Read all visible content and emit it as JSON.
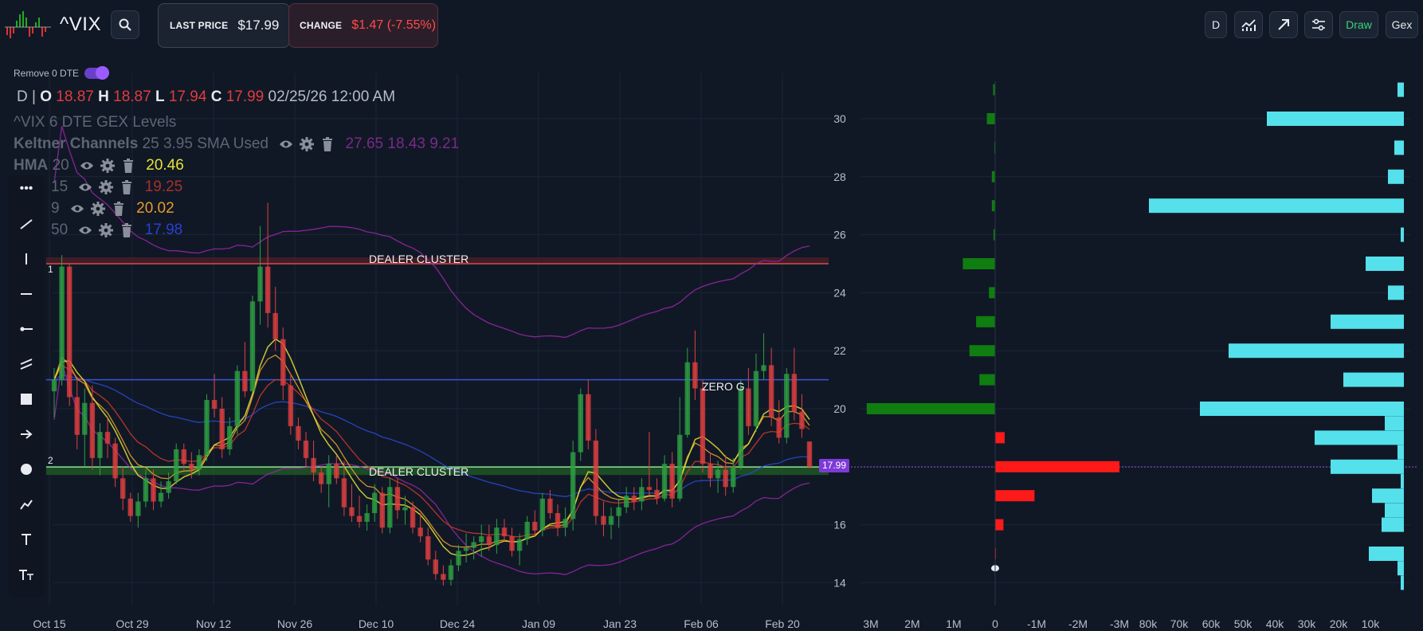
{
  "header": {
    "ticker": "^VIX",
    "last_price_label": "LAST PRICE",
    "last_price_value": "$17.99",
    "change_label": "CHANGE",
    "change_value": "$1.47 (-7.55%)",
    "interval_button": "D",
    "draw_button": "Draw",
    "gex_button": "Gex",
    "icons": [
      "search-icon",
      "chart-indicators-icon",
      "trend-arrow-icon",
      "settings-sliders-icon"
    ]
  },
  "controls": {
    "remove_dte_label": "Remove 0 DTE",
    "remove_dte_on": true
  },
  "legend": {
    "interval": "D",
    "o_label": "O",
    "open": "18.87",
    "h_label": "H",
    "high": "18.87",
    "l_label": "L",
    "low": "17.94",
    "c_label": "C",
    "close": "17.99",
    "datetime": "02/25/26 12:00 AM",
    "gex_title": "^VIX 6 DTE GEX Levels",
    "keltner_name": "Keltner Channels",
    "keltner_params": "25 3.95 SMA Used",
    "keltner_values": "27.65 18.43 9.21",
    "hma_name": "HMA",
    "hma_period": "20",
    "hma_value": "20.46",
    "ma2_period": "15",
    "ma2_value": "19.25",
    "ma3_period": "9",
    "ma3_value": "20.02",
    "ma4_period": "50",
    "ma4_value": "17.98"
  },
  "annotations": {
    "dealer_cluster_top": "DEALER CLUSTER",
    "dealer_cluster_bottom": "DEALER CLUSTER",
    "zero_g": "ZERO G",
    "marker_1": "1",
    "marker_2": "2",
    "price_tag": "17.99"
  },
  "colors": {
    "background": "#101826",
    "up": "#2ea043",
    "down": "#e04040",
    "gex_pos": "#0f7d10",
    "gex_neg": "#ff1a1a",
    "volume": "#54e1eb",
    "zero_g": "#3b55d6",
    "dealer": "#e04a4a",
    "keltner": "#9a27a8",
    "hma": "#e7e236",
    "ma15": "#d23a2a",
    "ma9": "#f0a52a",
    "ma50": "#2a4bd6"
  },
  "chart_data": [
    {
      "type": "candlestick",
      "x_labels": [
        "Oct 15",
        "Oct 29",
        "Nov 12",
        "Nov 26",
        "Dec 10",
        "Dec 24",
        "Jan 09",
        "Jan 23",
        "Feb 06",
        "Feb 20"
      ],
      "ylim": [
        13.5,
        31.5
      ],
      "levels": {
        "dealer_cluster_top": 25.0,
        "zero_g": 21.0,
        "dealer_cluster_bottom": 17.99
      },
      "ohlc": [
        [
          20.6,
          21.4,
          19.7,
          21.0
        ],
        [
          21.0,
          25.3,
          20.8,
          24.9
        ],
        [
          24.9,
          25.0,
          20.1,
          20.4
        ],
        [
          20.4,
          21.0,
          18.6,
          19.1
        ],
        [
          19.1,
          20.7,
          18.0,
          20.2
        ],
        [
          20.2,
          20.8,
          17.9,
          18.3
        ],
        [
          18.3,
          19.5,
          17.7,
          19.2
        ],
        [
          19.2,
          19.7,
          18.3,
          18.8
        ],
        [
          18.8,
          19.0,
          17.3,
          17.6
        ],
        [
          17.6,
          18.0,
          16.5,
          16.9
        ],
        [
          16.9,
          17.1,
          16.1,
          16.3
        ],
        [
          16.3,
          17.1,
          15.9,
          16.8
        ],
        [
          16.8,
          17.9,
          16.6,
          17.6
        ],
        [
          17.6,
          17.9,
          16.5,
          16.8
        ],
        [
          16.8,
          17.5,
          16.6,
          17.1
        ],
        [
          17.1,
          17.8,
          16.9,
          17.5
        ],
        [
          17.5,
          18.8,
          17.4,
          18.6
        ],
        [
          18.6,
          18.8,
          17.9,
          18.1
        ],
        [
          18.1,
          18.5,
          17.6,
          17.9
        ],
        [
          17.9,
          18.6,
          17.7,
          18.4
        ],
        [
          18.4,
          20.5,
          18.2,
          20.3
        ],
        [
          20.3,
          21.2,
          19.7,
          20.0
        ],
        [
          20.0,
          20.4,
          18.3,
          18.6
        ],
        [
          18.6,
          19.7,
          18.4,
          19.4
        ],
        [
          19.4,
          21.5,
          19.1,
          21.3
        ],
        [
          21.3,
          22.3,
          20.4,
          20.6
        ],
        [
          20.6,
          23.9,
          20.6,
          23.7
        ],
        [
          23.7,
          26.3,
          22.9,
          24.9
        ],
        [
          24.9,
          27.1,
          22.8,
          23.3
        ],
        [
          23.3,
          24.2,
          22.0,
          22.4
        ],
        [
          22.4,
          22.8,
          20.3,
          20.8
        ],
        [
          20.8,
          21.2,
          19.1,
          19.4
        ],
        [
          19.4,
          19.7,
          18.6,
          18.9
        ],
        [
          18.9,
          19.2,
          18.0,
          18.3
        ],
        [
          18.3,
          18.9,
          17.5,
          17.8
        ],
        [
          17.8,
          18.0,
          17.1,
          17.4
        ],
        [
          17.4,
          18.4,
          16.6,
          18.1
        ],
        [
          18.1,
          18.4,
          17.4,
          17.6
        ],
        [
          17.6,
          18.2,
          16.3,
          16.6
        ],
        [
          16.6,
          17.4,
          16.1,
          16.3
        ],
        [
          16.3,
          17.0,
          15.9,
          16.1
        ],
        [
          16.1,
          16.7,
          15.8,
          16.4
        ],
        [
          16.4,
          17.4,
          16.1,
          17.1
        ],
        [
          17.1,
          17.3,
          15.7,
          15.9
        ],
        [
          15.9,
          17.6,
          15.7,
          17.3
        ],
        [
          17.3,
          17.6,
          16.2,
          16.5
        ],
        [
          16.5,
          17.0,
          16.0,
          16.6
        ],
        [
          16.6,
          16.8,
          15.7,
          15.9
        ],
        [
          15.9,
          16.4,
          15.4,
          15.6
        ],
        [
          15.6,
          15.9,
          14.6,
          14.8
        ],
        [
          14.8,
          15.1,
          14.1,
          14.3
        ],
        [
          14.3,
          14.6,
          13.9,
          14.1
        ],
        [
          14.1,
          14.8,
          13.9,
          14.6
        ],
        [
          14.6,
          15.3,
          14.4,
          15.1
        ],
        [
          15.1,
          15.7,
          14.7,
          15.2
        ],
        [
          15.2,
          15.6,
          14.8,
          15.4
        ],
        [
          15.4,
          16.0,
          14.9,
          15.6
        ],
        [
          15.6,
          16.0,
          15.1,
          15.3
        ],
        [
          15.3,
          16.2,
          15.0,
          15.9
        ],
        [
          15.9,
          16.2,
          15.4,
          15.6
        ],
        [
          15.6,
          15.9,
          14.9,
          15.1
        ],
        [
          15.1,
          15.7,
          14.6,
          15.5
        ],
        [
          15.5,
          16.3,
          15.3,
          16.1
        ],
        [
          16.1,
          16.5,
          15.6,
          15.8
        ],
        [
          15.8,
          17.1,
          15.6,
          16.9
        ],
        [
          16.9,
          17.2,
          16.2,
          16.4
        ],
        [
          16.4,
          16.7,
          15.6,
          15.9
        ],
        [
          15.9,
          16.6,
          15.6,
          16.2
        ],
        [
          16.2,
          18.9,
          15.8,
          18.5
        ],
        [
          18.5,
          20.7,
          18.2,
          20.5
        ],
        [
          20.5,
          21.0,
          18.6,
          18.9
        ],
        [
          18.9,
          19.3,
          16.0,
          16.3
        ],
        [
          16.3,
          16.8,
          15.6,
          16.0
        ],
        [
          16.0,
          16.6,
          15.5,
          16.3
        ],
        [
          16.3,
          16.9,
          15.9,
          16.6
        ],
        [
          16.6,
          17.3,
          16.4,
          17.0
        ],
        [
          17.0,
          17.3,
          16.5,
          16.8
        ],
        [
          16.8,
          17.6,
          16.5,
          17.3
        ],
        [
          17.3,
          19.2,
          17.0,
          17.2
        ],
        [
          17.2,
          17.6,
          16.7,
          16.9
        ],
        [
          16.9,
          18.4,
          16.8,
          18.1
        ],
        [
          18.1,
          18.5,
          16.6,
          16.9
        ],
        [
          16.9,
          20.4,
          16.8,
          19.1
        ],
        [
          19.1,
          22.1,
          19.0,
          21.6
        ],
        [
          21.6,
          22.7,
          20.3,
          20.7
        ],
        [
          20.7,
          21.0,
          17.8,
          18.1
        ],
        [
          18.1,
          18.5,
          17.3,
          17.6
        ],
        [
          17.6,
          18.2,
          17.1,
          17.9
        ],
        [
          17.9,
          18.4,
          17.0,
          17.3
        ],
        [
          17.3,
          18.3,
          17.1,
          18.0
        ],
        [
          18.0,
          21.0,
          17.9,
          20.7
        ],
        [
          20.7,
          21.4,
          19.1,
          19.4
        ],
        [
          19.4,
          21.9,
          19.2,
          21.3
        ],
        [
          21.3,
          22.6,
          21.0,
          21.5
        ],
        [
          21.5,
          22.1,
          19.4,
          19.7
        ],
        [
          19.7,
          20.3,
          18.8,
          19.0
        ],
        [
          19.0,
          21.4,
          18.8,
          21.2
        ],
        [
          21.2,
          22.1,
          19.6,
          19.9
        ],
        [
          19.9,
          20.5,
          19.0,
          19.3
        ],
        [
          18.87,
          18.87,
          17.94,
          17.99
        ]
      ]
    },
    {
      "type": "bar",
      "name": "GEX",
      "orientation": "horizontal",
      "strikes": [
        31,
        30,
        29,
        28,
        27,
        26,
        25,
        24,
        23,
        22,
        21,
        20,
        19,
        18,
        17,
        16,
        15,
        14.5
      ],
      "values": [
        -0.05,
        -0.2,
        -0.02,
        -0.08,
        -0.08,
        -0.04,
        -0.78,
        -0.15,
        -0.46,
        -0.62,
        -0.38,
        -3.1,
        0.23,
        3.0,
        0.95,
        0.2,
        0.02,
        0.0
      ],
      "x_tick_labels": [
        "3M",
        "2M",
        "1M",
        "0",
        "-1M",
        "-2M",
        "-3M"
      ],
      "y_tick_labels": [
        "30",
        "28",
        "26",
        "24",
        "22",
        "20",
        "18",
        "16",
        "14"
      ]
    },
    {
      "type": "bar",
      "name": "Open interest",
      "orientation": "horizontal",
      "strikes": [
        31,
        30,
        29,
        28,
        27,
        26,
        25,
        24,
        23,
        22,
        21,
        20,
        19.5,
        19,
        18.5,
        18,
        17.5,
        17,
        16.5,
        16,
        15,
        14.5,
        14
      ],
      "values": [
        2,
        43,
        3,
        5,
        80,
        1,
        12,
        5,
        23,
        55,
        19,
        64,
        6,
        28,
        2,
        23,
        1,
        10,
        6,
        7,
        11,
        2,
        1
      ],
      "x_tick_labels": [
        "80k",
        "70k",
        "60k",
        "50k",
        "40k",
        "30k",
        "20k",
        "10k"
      ]
    }
  ]
}
